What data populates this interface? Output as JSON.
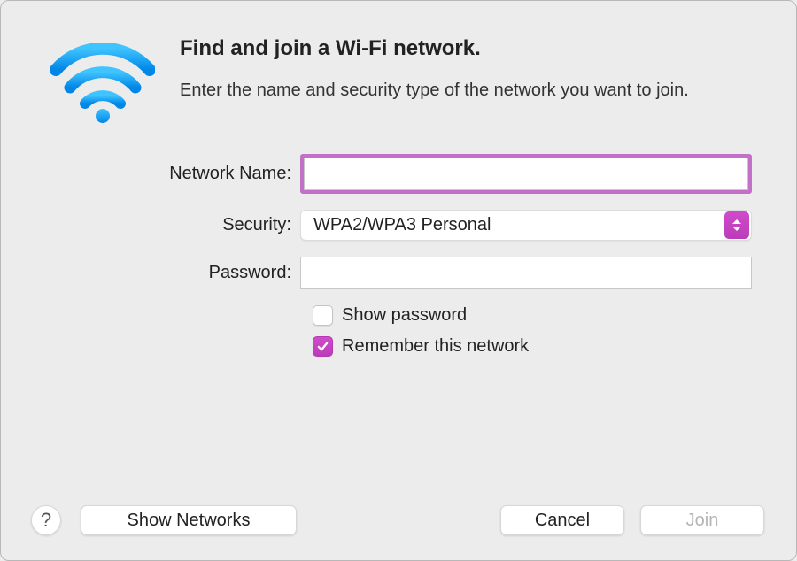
{
  "header": {
    "title": "Find and join a Wi-Fi network.",
    "subtitle": "Enter the name and security type of the network you want to join."
  },
  "form": {
    "network_name_label": "Network Name:",
    "network_name_value": "",
    "security_label": "Security:",
    "security_value": "WPA2/WPA3 Personal",
    "password_label": "Password:",
    "password_value": "",
    "show_password_label": "Show password",
    "show_password_checked": false,
    "remember_label": "Remember this network",
    "remember_checked": true
  },
  "footer": {
    "help_label": "?",
    "show_networks_label": "Show Networks",
    "cancel_label": "Cancel",
    "join_label": "Join",
    "join_enabled": false
  }
}
